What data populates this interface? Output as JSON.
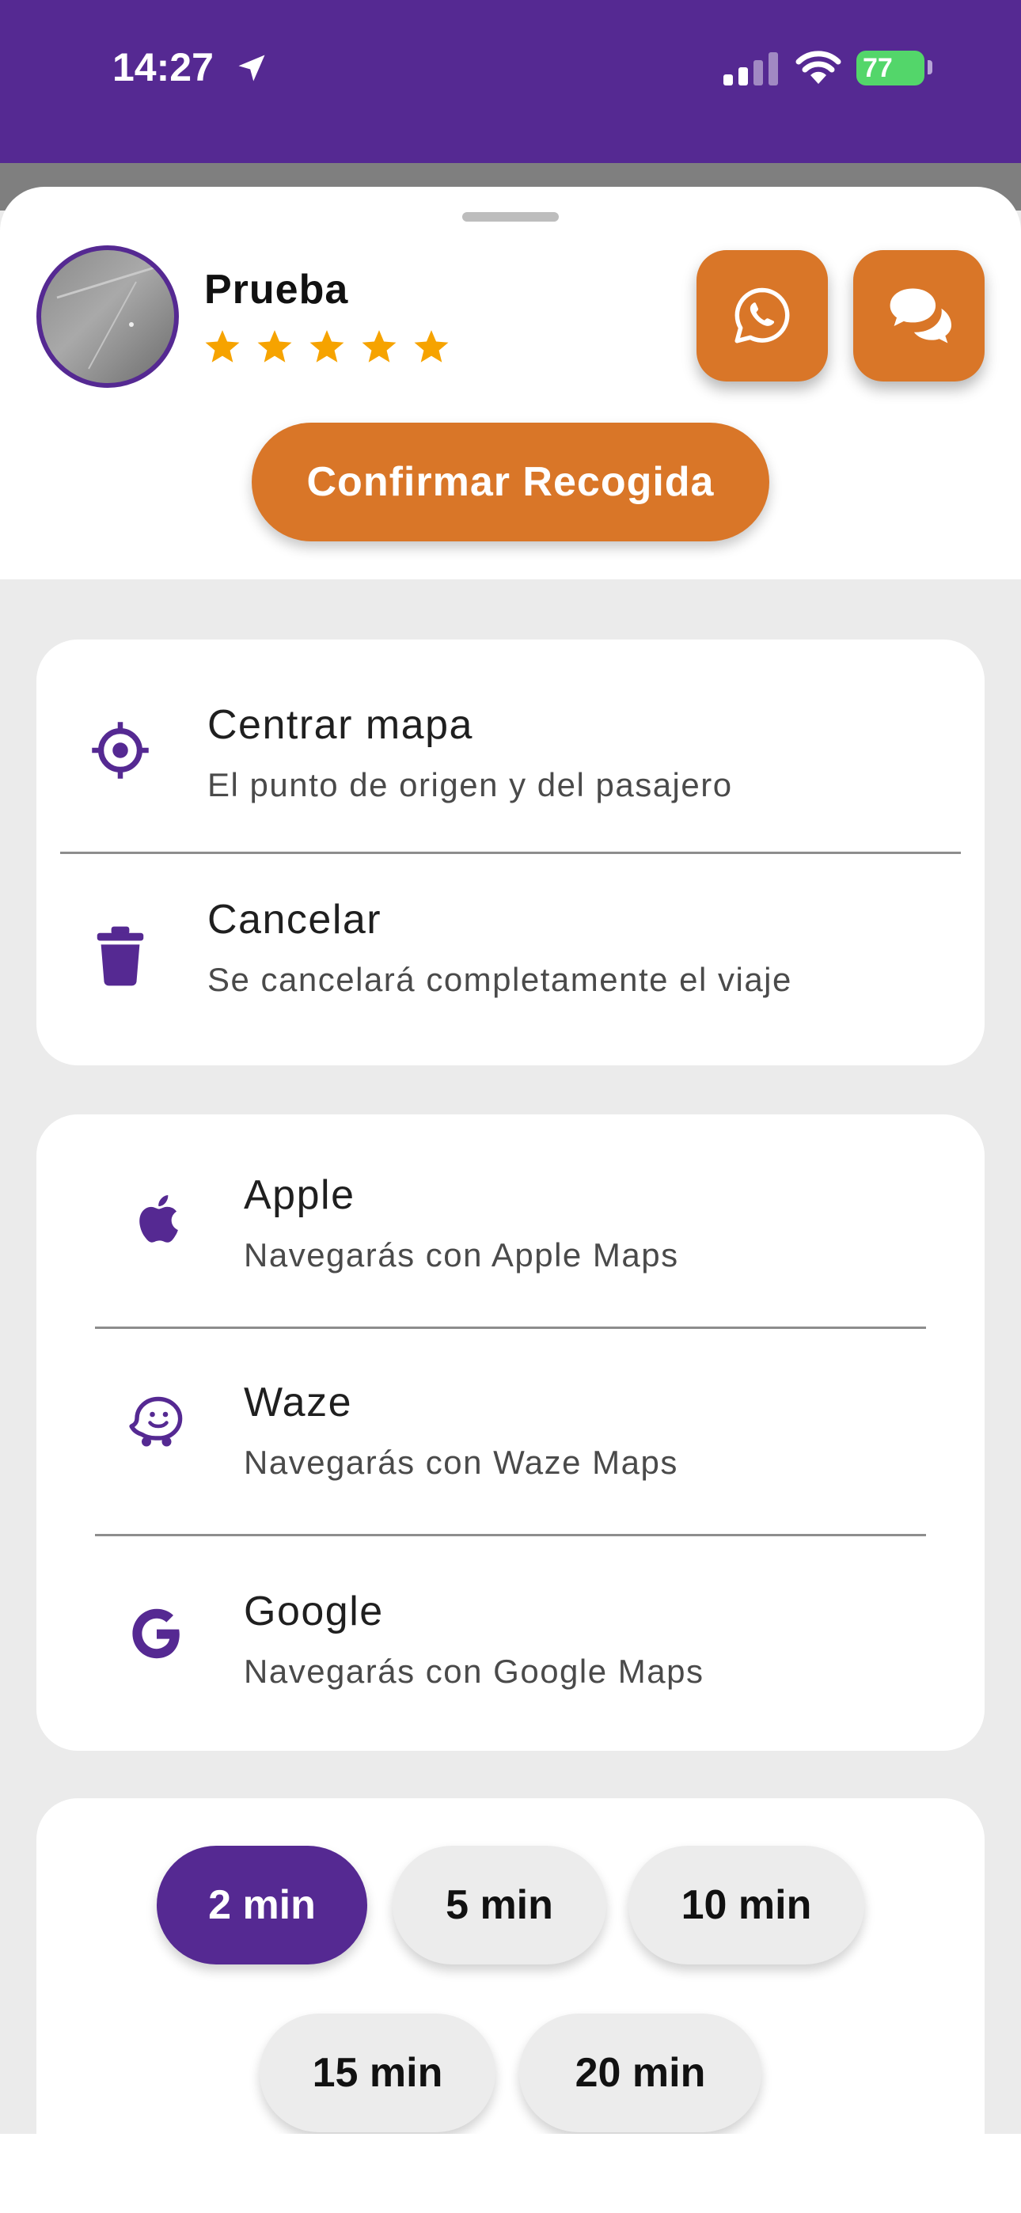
{
  "status_bar": {
    "time": "14:27",
    "battery": "77"
  },
  "driver": {
    "name": "Prueba",
    "rating": 5
  },
  "actions": {
    "whatsapp_icon": "whatsapp-icon",
    "chat_icon": "chat-bubbles-icon"
  },
  "confirm_button": {
    "label": "Confirmar Recogida"
  },
  "options": [
    {
      "title": "Centrar mapa",
      "subtitle": "El punto de origen y del pasajero",
      "icon": "crosshair-icon"
    },
    {
      "title": "Cancelar",
      "subtitle": "Se cancelará completamente el viaje",
      "icon": "trash-icon"
    }
  ],
  "navigation": [
    {
      "title": "Apple",
      "subtitle": "Navegarás con Apple Maps",
      "icon": "apple-icon"
    },
    {
      "title": "Waze",
      "subtitle": "Navegarás con Waze Maps",
      "icon": "waze-icon"
    },
    {
      "title": "Google",
      "subtitle": "Navegarás con Google Maps",
      "icon": "google-icon"
    }
  ],
  "wait_times": {
    "selected": "2 min",
    "options": [
      "2 min",
      "5 min",
      "10 min",
      "15 min",
      "20 min"
    ]
  },
  "colors": {
    "brand": "#552992",
    "accent": "#d97628",
    "star": "#f6a300"
  }
}
